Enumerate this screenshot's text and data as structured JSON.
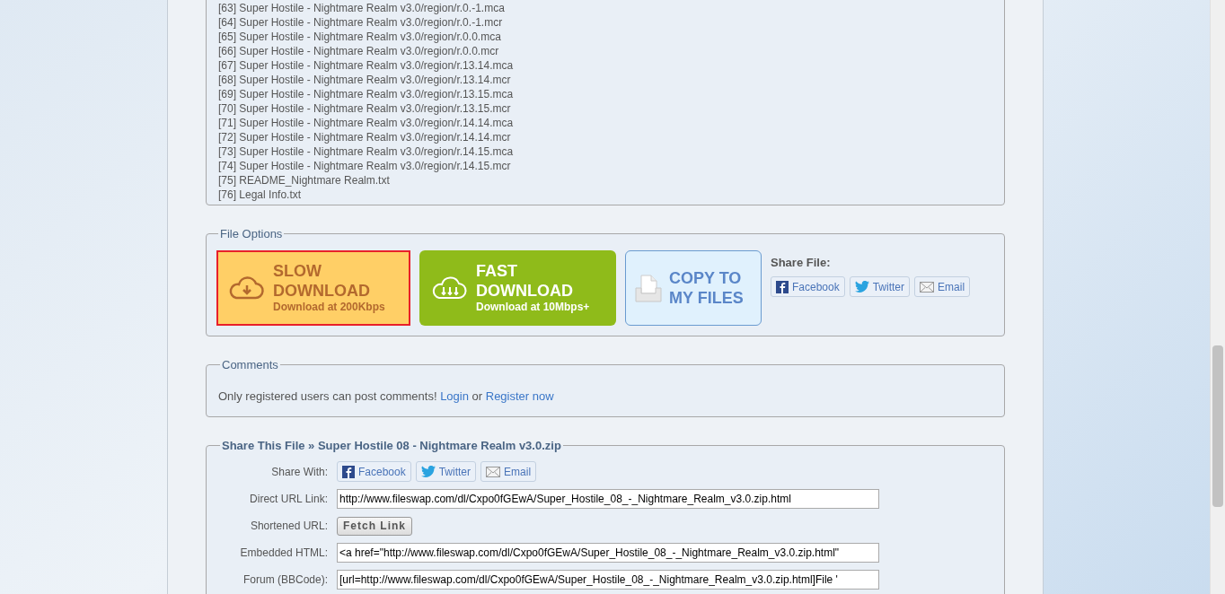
{
  "file_list": [
    "[63] Super Hostile - Nightmare Realm v3.0/region/r.0.-1.mca",
    "[64] Super Hostile - Nightmare Realm v3.0/region/r.0.-1.mcr",
    "[65] Super Hostile - Nightmare Realm v3.0/region/r.0.0.mca",
    "[66] Super Hostile - Nightmare Realm v3.0/region/r.0.0.mcr",
    "[67] Super Hostile - Nightmare Realm v3.0/region/r.13.14.mca",
    "[68] Super Hostile - Nightmare Realm v3.0/region/r.13.14.mcr",
    "[69] Super Hostile - Nightmare Realm v3.0/region/r.13.15.mca",
    "[70] Super Hostile - Nightmare Realm v3.0/region/r.13.15.mcr",
    "[71] Super Hostile - Nightmare Realm v3.0/region/r.14.14.mca",
    "[72] Super Hostile - Nightmare Realm v3.0/region/r.14.14.mcr",
    "[73] Super Hostile - Nightmare Realm v3.0/region/r.14.15.mca",
    "[74] Super Hostile - Nightmare Realm v3.0/region/r.14.15.mcr",
    "[75] README_Nightmare Realm.txt",
    "[76] Legal Info.txt"
  ],
  "file_options": {
    "legend": "File Options",
    "buttons": [
      {
        "kind": "slow",
        "title_lines": [
          "SLOW",
          "DOWNLOAD"
        ],
        "subtitle": "Download at 200Kbps",
        "selected": true
      },
      {
        "kind": "fast",
        "title_lines": [
          "FAST",
          "DOWNLOAD"
        ],
        "subtitle": "Download at 10Mbps+",
        "selected": false
      },
      {
        "kind": "copy",
        "title_lines": [
          "COPY TO",
          "MY FILES"
        ],
        "selected": false
      }
    ],
    "share_label": "Share File:",
    "share_buttons": [
      {
        "kind": "facebook",
        "label": "Facebook"
      },
      {
        "kind": "twitter",
        "label": "Twitter"
      },
      {
        "kind": "email",
        "label": "Email"
      }
    ]
  },
  "comments": {
    "legend": "Comments",
    "message": "Only registered users can post comments!",
    "login": "Login",
    "separator": "or",
    "register": "Register now"
  },
  "share_this_file": {
    "legend": "Share This File » Super Hostile 08 - Nightmare Realm v3.0.zip",
    "rows": [
      {
        "kind": "share",
        "label": "Share With:",
        "buttons": [
          {
            "kind": "facebook",
            "label": "Facebook"
          },
          {
            "kind": "twitter",
            "label": "Twitter"
          },
          {
            "kind": "email",
            "label": "Email"
          }
        ]
      },
      {
        "kind": "field",
        "label": "Direct URL Link:",
        "value": "http://www.fileswap.com/dl/Cxpo0fGEwA/Super_Hostile_08_-_Nightmare_Realm_v3.0.zip.html"
      },
      {
        "kind": "button",
        "label": "Shortened URL:",
        "button": "Fetch Link"
      },
      {
        "kind": "field",
        "label": "Embedded HTML:",
        "value": "<a href=\"http://www.fileswap.com/dl/Cxpo0fGEwA/Super_Hostile_08_-_Nightmare_Realm_v3.0.zip.html\""
      },
      {
        "kind": "field",
        "label": "Forum (BBCode):",
        "value": "[url=http://www.fileswap.com/dl/Cxpo0fGEwA/Super_Hostile_08_-_Nightmare_Realm_v3.0.zip.html]File '"
      }
    ]
  }
}
